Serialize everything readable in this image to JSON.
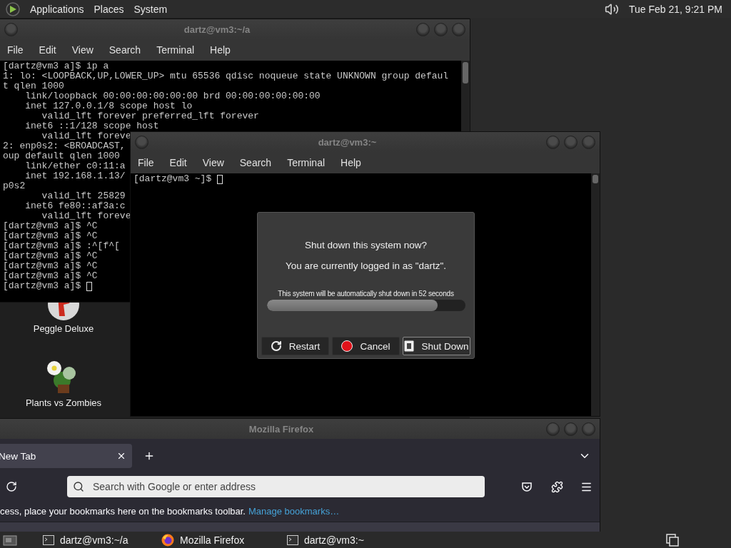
{
  "top_panel": {
    "menus": [
      "Applications",
      "Places",
      "System"
    ],
    "clock": "Tue Feb 21, 9:21 PM"
  },
  "desktop_icons": [
    {
      "label": "Peggle Deluxe",
      "kind": "peggle"
    },
    {
      "label": "Plants vs Zombies",
      "kind": "plant"
    }
  ],
  "windows": [
    {
      "kind": "terminal",
      "title": "dartz@vm3:~/a",
      "menu": [
        "File",
        "Edit",
        "View",
        "Search",
        "Terminal",
        "Help"
      ],
      "cursor": true,
      "lines": [
        "[dartz@vm3 a]$ ip a",
        "1: lo: <LOOPBACK,UP,LOWER_UP> mtu 65536 qdisc noqueue state UNKNOWN group defaul",
        "t qlen 1000",
        "    link/loopback 00:00:00:00:00:00 brd 00:00:00:00:00:00",
        "    inet 127.0.0.1/8 scope host lo",
        "       valid_lft forever preferred_lft forever",
        "    inet6 ::1/128 scope host",
        "       valid_lft foreve",
        "2: enp0s2: <BROADCAST,",
        "oup default qlen 1000",
        "    link/ether c0:11:a",
        "    inet 192.168.1.13/",
        "p0s2",
        "       valid_lft 25829",
        "    inet6 fe80::af3a:c",
        "       valid_lft foreve",
        "[dartz@vm3 a]$ ^C",
        "[dartz@vm3 a]$ ^C",
        "[dartz@vm3 a]$ :^[f^[",
        "[dartz@vm3 a]$ ^C",
        "[dartz@vm3 a]$ ^C",
        "[dartz@vm3 a]$ ^C",
        "[dartz@vm3 a]$ "
      ]
    },
    {
      "kind": "terminal",
      "title": "dartz@vm3:~",
      "menu": [
        "File",
        "Edit",
        "View",
        "Search",
        "Terminal",
        "Help"
      ],
      "cursor": true,
      "lines": [
        "[dartz@vm3 ~]$ "
      ]
    },
    {
      "kind": "browser",
      "title": "Mozilla Firefox",
      "tabs": [
        {
          "label": "New Tab",
          "selected": true
        }
      ],
      "address_bar": {
        "placeholder": "Search with Google or enter address"
      },
      "bookmarks_bar": {
        "text": "cess, place your bookmarks here on the bookmarks toolbar.",
        "link": "Manage bookmarks…"
      }
    }
  ],
  "dialog": {
    "title": "Shut down this system now?",
    "message": "You are currently logged in as \"dartz\".",
    "countdown": "This system will be automatically shut down in 52 seconds",
    "progress": {
      "level": 0.86
    },
    "buttons": [
      {
        "label": "Restart",
        "kind": "restart",
        "selected": false
      },
      {
        "label": "Cancel",
        "kind": "cancel",
        "selected": false
      },
      {
        "label": "Shut Down",
        "kind": "shutdown",
        "selected": true
      }
    ]
  },
  "taskbar": {
    "items": [
      {
        "label": "dartz@vm3:~/a",
        "kind": "terminal"
      },
      {
        "label": "Mozilla Firefox",
        "kind": "browser"
      },
      {
        "label": "dartz@vm3:~",
        "kind": "terminal"
      }
    ]
  }
}
